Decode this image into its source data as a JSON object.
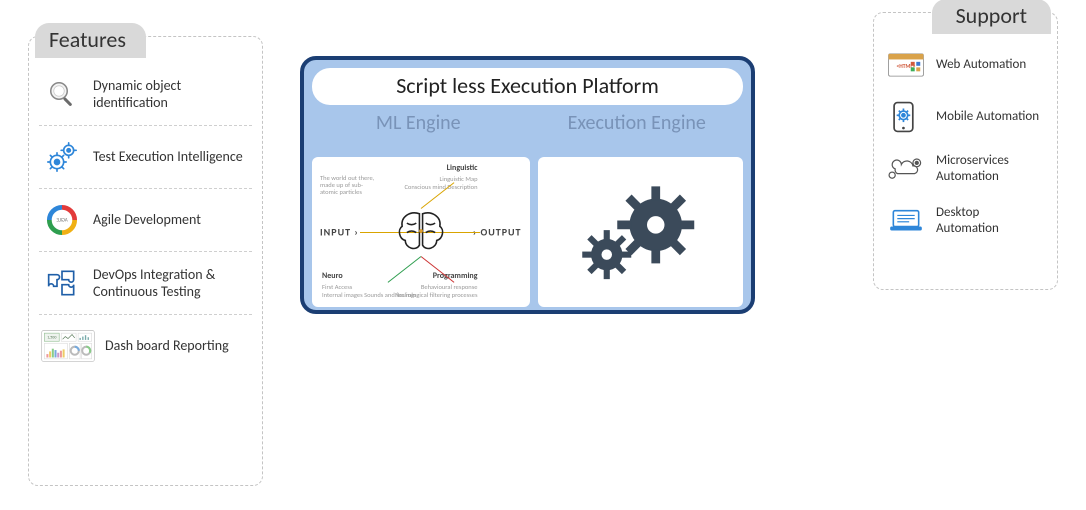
{
  "features": {
    "header": "Features",
    "items": [
      {
        "label": "Dynamic object identification",
        "icon": "magnifier-icon"
      },
      {
        "label": "Test Execution Intelligence",
        "icon": "gears-blue-icon"
      },
      {
        "label": "Agile Development",
        "icon": "agile-cycle-icon"
      },
      {
        "label": "DevOps Integration & Continuous Testing",
        "icon": "puzzle-icon"
      },
      {
        "label": "Dash board Reporting",
        "icon": "dashboard-icon"
      }
    ]
  },
  "support": {
    "header": "Support",
    "items": [
      {
        "label": "Web Automation",
        "icon": "browser-icon"
      },
      {
        "label": "Mobile Automation",
        "icon": "mobile-gear-icon"
      },
      {
        "label": "Microservices Automation",
        "icon": "cloud-api-icon"
      },
      {
        "label": "Desktop Automation",
        "icon": "laptop-icon"
      }
    ]
  },
  "platform": {
    "title": "Script less Execution Platform",
    "engines": [
      {
        "name": "ML Engine"
      },
      {
        "name": "Execution Engine"
      }
    ],
    "ml_labels": {
      "input": "INPUT ›",
      "output": "› OUTPUT",
      "intro": "The world out there, made up of sub-atomic particles",
      "linguistic": "Linguistic",
      "linguistic_map": "Linguistic Map",
      "linguistic_map_sub": "Conscious mind Description",
      "neuro": "Neuro",
      "first_access": "First Access",
      "first_access_sub": "Internal images Sounds and feelings",
      "programming": "Programming",
      "behavioural": "Behavioural response",
      "behavioural_sub": "Neurological filtering processes"
    }
  },
  "colors": {
    "panel_header_bg": "#d9d9d9",
    "platform_bg": "#a8c6eb",
    "platform_border": "#1b3e73",
    "engine_head": "#7993b8",
    "gear_dark": "#3b4a5a"
  }
}
